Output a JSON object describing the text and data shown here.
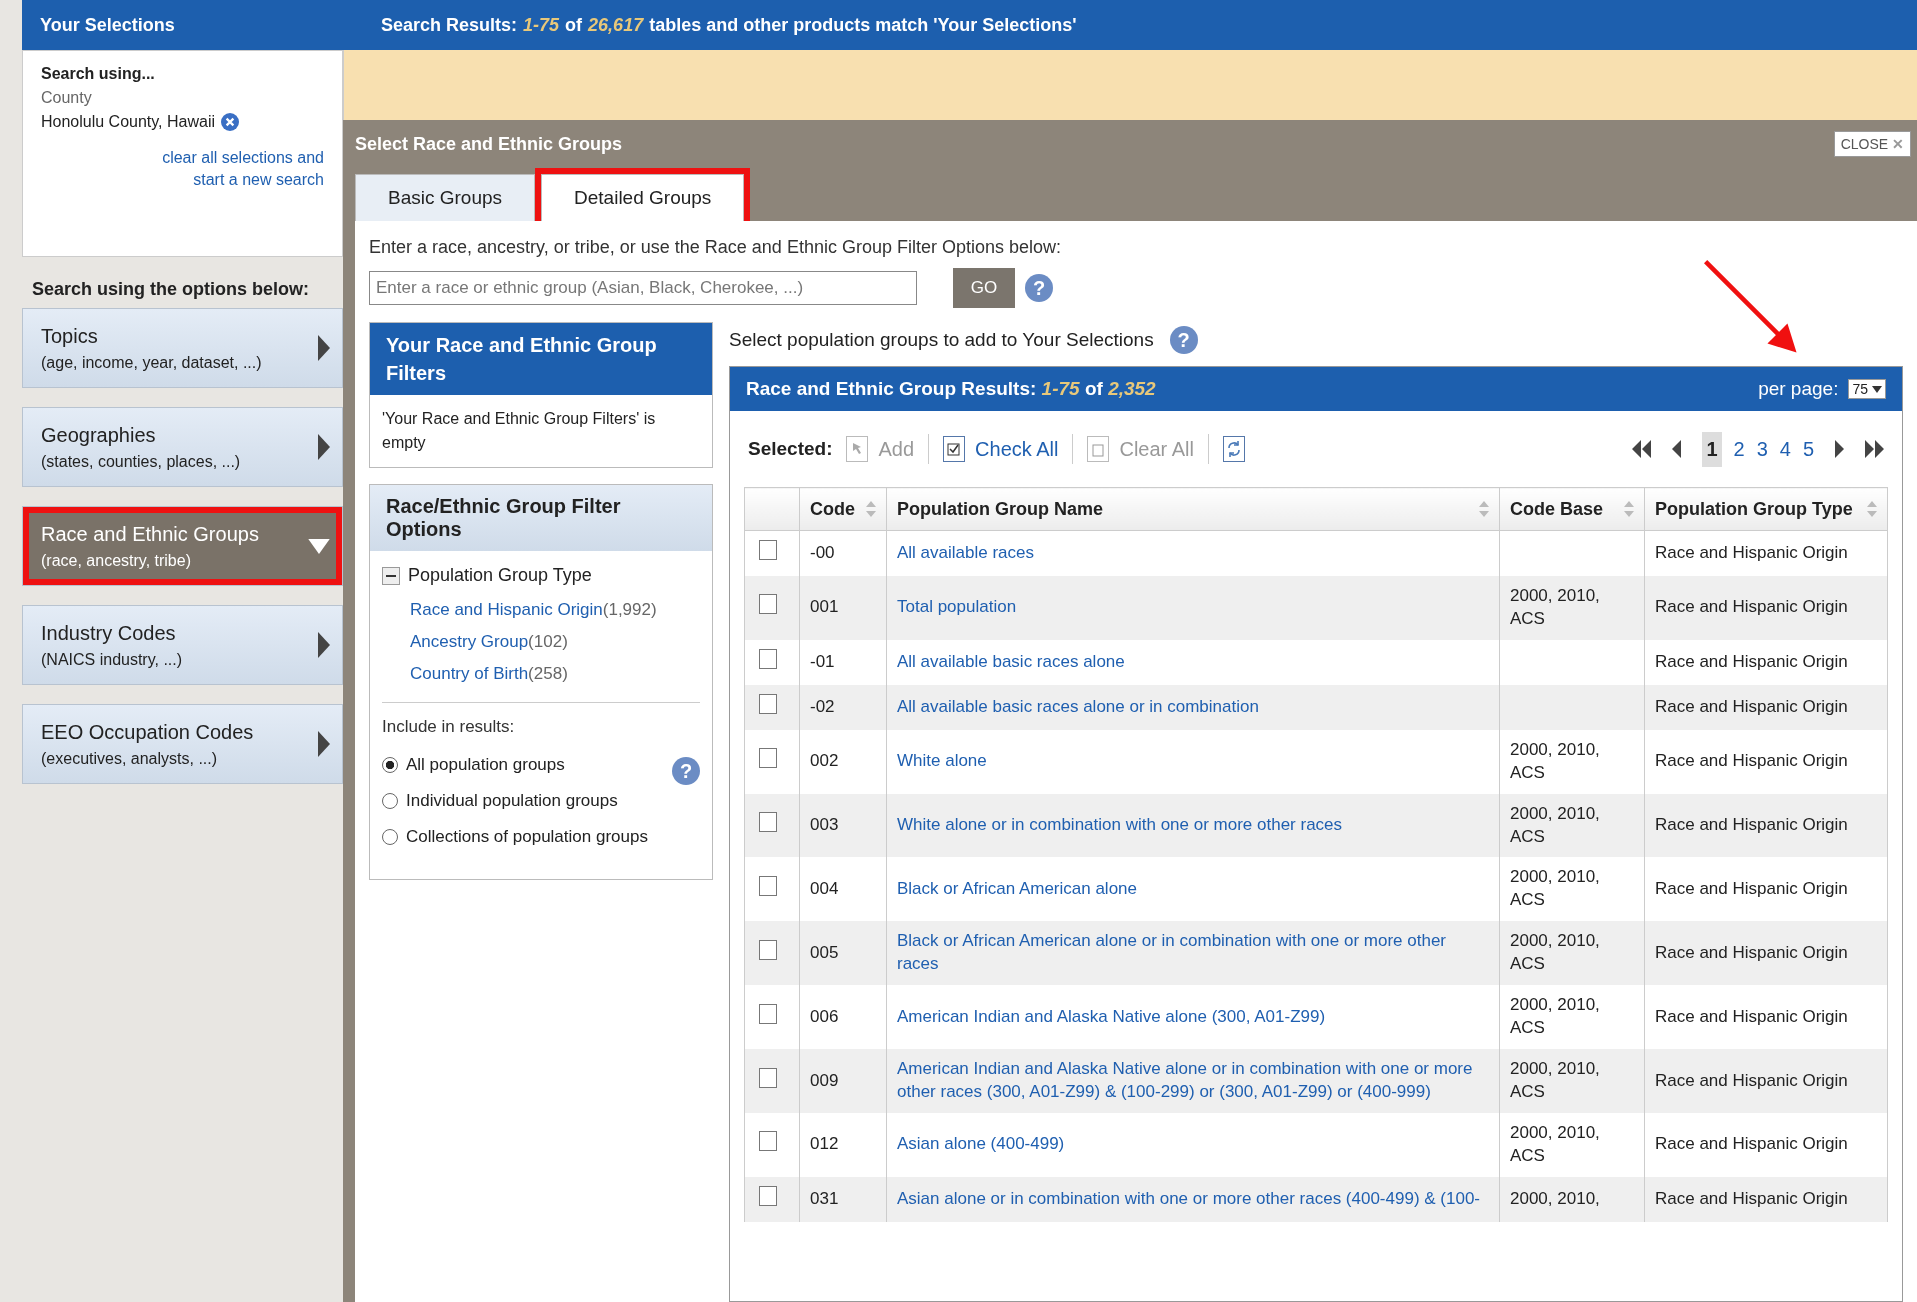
{
  "sidebar": {
    "title": "Your Selections",
    "search_using_label": "Search using...",
    "selection_type": "County",
    "selection_value": "Honolulu County, Hawaii",
    "clear_link": "clear all selections and start a new search",
    "options_heading": "Search using the options below:",
    "items": [
      {
        "title": "Topics",
        "subtitle": "(age, income, year, dataset, ...)",
        "expanded": false,
        "highlighted": false
      },
      {
        "title": "Geographies",
        "subtitle": "(states, counties, places, ...)",
        "expanded": false,
        "highlighted": false
      },
      {
        "title": "Race and Ethnic Groups",
        "subtitle": "(race, ancestry, tribe)",
        "expanded": true,
        "highlighted": true
      },
      {
        "title": "Industry Codes",
        "subtitle": "(NAICS industry, ...)",
        "expanded": false,
        "highlighted": false
      },
      {
        "title": "EEO Occupation Codes",
        "subtitle": "(executives, analysts, ...)",
        "expanded": false,
        "highlighted": false
      }
    ]
  },
  "results_header": {
    "label": "Search Results:",
    "range": "1-75",
    "of": "of",
    "total": "26,617",
    "suffix": "tables and other products match 'Your Selections'"
  },
  "modal": {
    "title": "Select Race and Ethnic Groups",
    "close": "CLOSE",
    "close_icon": "✕",
    "tabs": [
      {
        "label": "Basic Groups",
        "selected": false,
        "highlighted": false
      },
      {
        "label": "Detailed Groups",
        "selected": true,
        "highlighted": true
      }
    ],
    "prompt": "Enter a race, ancestry, or tribe, or use the Race and Ethnic Group Filter Options below:",
    "search": {
      "placeholder": "Enter a race or ethnic group (Asian, Black, Cherokee, ...)",
      "button": "GO",
      "help": "?"
    },
    "filters_box": {
      "title": "Your Race and Ethnic Group Filters",
      "empty_text": "'Your Race and Ethnic Group Filters' is empty"
    },
    "filter_options": {
      "title": "Race/Ethnic Group Filter Options",
      "group": {
        "label": "Population Group Type",
        "expanded": true,
        "items": [
          {
            "label": "Race and Hispanic Origin",
            "count": "(1,992)"
          },
          {
            "label": "Ancestry Group",
            "count": "(102)"
          },
          {
            "label": "Country of Birth",
            "count": "(258)"
          }
        ]
      },
      "include_label": "Include in results:",
      "include_options": [
        {
          "label": "All population groups",
          "selected": true
        },
        {
          "label": "Individual population groups",
          "selected": false
        },
        {
          "label": "Collections of population groups",
          "selected": false
        }
      ],
      "help": "?"
    },
    "instruction": "Select population groups to add to Your Selections",
    "instruction_help": "?",
    "results": {
      "label": "Race and Ethnic Group Results:",
      "range": "1-75",
      "of": "of",
      "total": "2,352",
      "per_page_label": "per page:",
      "per_page": "75",
      "toolbar": {
        "selected_label": "Selected:",
        "add": "Add",
        "check_all": "Check All",
        "clear_all": "Clear All"
      },
      "pages": [
        {
          "label": "1",
          "selected": true
        },
        {
          "label": "2",
          "selected": false
        },
        {
          "label": "3",
          "selected": false
        },
        {
          "label": "4",
          "selected": false
        },
        {
          "label": "5",
          "selected": false
        }
      ],
      "columns": [
        "Code",
        "Population Group Name",
        "Code Base",
        "Population Group Type"
      ],
      "rows": [
        {
          "checked": false,
          "code": "-00",
          "name": "All available races",
          "code_base": "",
          "type": "Race and Hispanic Origin"
        },
        {
          "checked": false,
          "code": "001",
          "name": "Total population",
          "code_base": "2000, 2010, ACS",
          "type": "Race and Hispanic Origin"
        },
        {
          "checked": false,
          "code": "-01",
          "name": "All available basic races alone",
          "code_base": "",
          "type": "Race and Hispanic Origin"
        },
        {
          "checked": false,
          "code": "-02",
          "name": "All available basic races alone or in combination",
          "code_base": "",
          "type": "Race and Hispanic Origin"
        },
        {
          "checked": false,
          "code": "002",
          "name": "White alone",
          "code_base": "2000, 2010, ACS",
          "type": "Race and Hispanic Origin"
        },
        {
          "checked": false,
          "code": "003",
          "name": "White alone or in combination with one or more other races",
          "code_base": "2000, 2010, ACS",
          "type": "Race and Hispanic Origin"
        },
        {
          "checked": false,
          "code": "004",
          "name": "Black or African American alone",
          "code_base": "2000, 2010, ACS",
          "type": "Race and Hispanic Origin"
        },
        {
          "checked": false,
          "code": "005",
          "name": "Black or African American alone or in combination with one or more other races",
          "code_base": "2000, 2010, ACS",
          "type": "Race and Hispanic Origin"
        },
        {
          "checked": false,
          "code": "006",
          "name": "American Indian and Alaska Native alone (300, A01-Z99)",
          "code_base": "2000, 2010, ACS",
          "type": "Race and Hispanic Origin"
        },
        {
          "checked": false,
          "code": "009",
          "name": "American Indian and Alaska Native alone or in combination with one or more other races (300, A01-Z99) & (100-299) or (300, A01-Z99) or (400-999)",
          "code_base": "2000, 2010, ACS",
          "type": "Race and Hispanic Origin"
        },
        {
          "checked": false,
          "code": "012",
          "name": "Asian alone (400-499)",
          "code_base": "2000, 2010, ACS",
          "type": "Race and Hispanic Origin"
        },
        {
          "checked": false,
          "code": "031",
          "name": "Asian alone or in combination with one or more other races (400-499) & (100-",
          "code_base": "2000, 2010,",
          "type": "Race and Hispanic Origin"
        }
      ]
    }
  }
}
